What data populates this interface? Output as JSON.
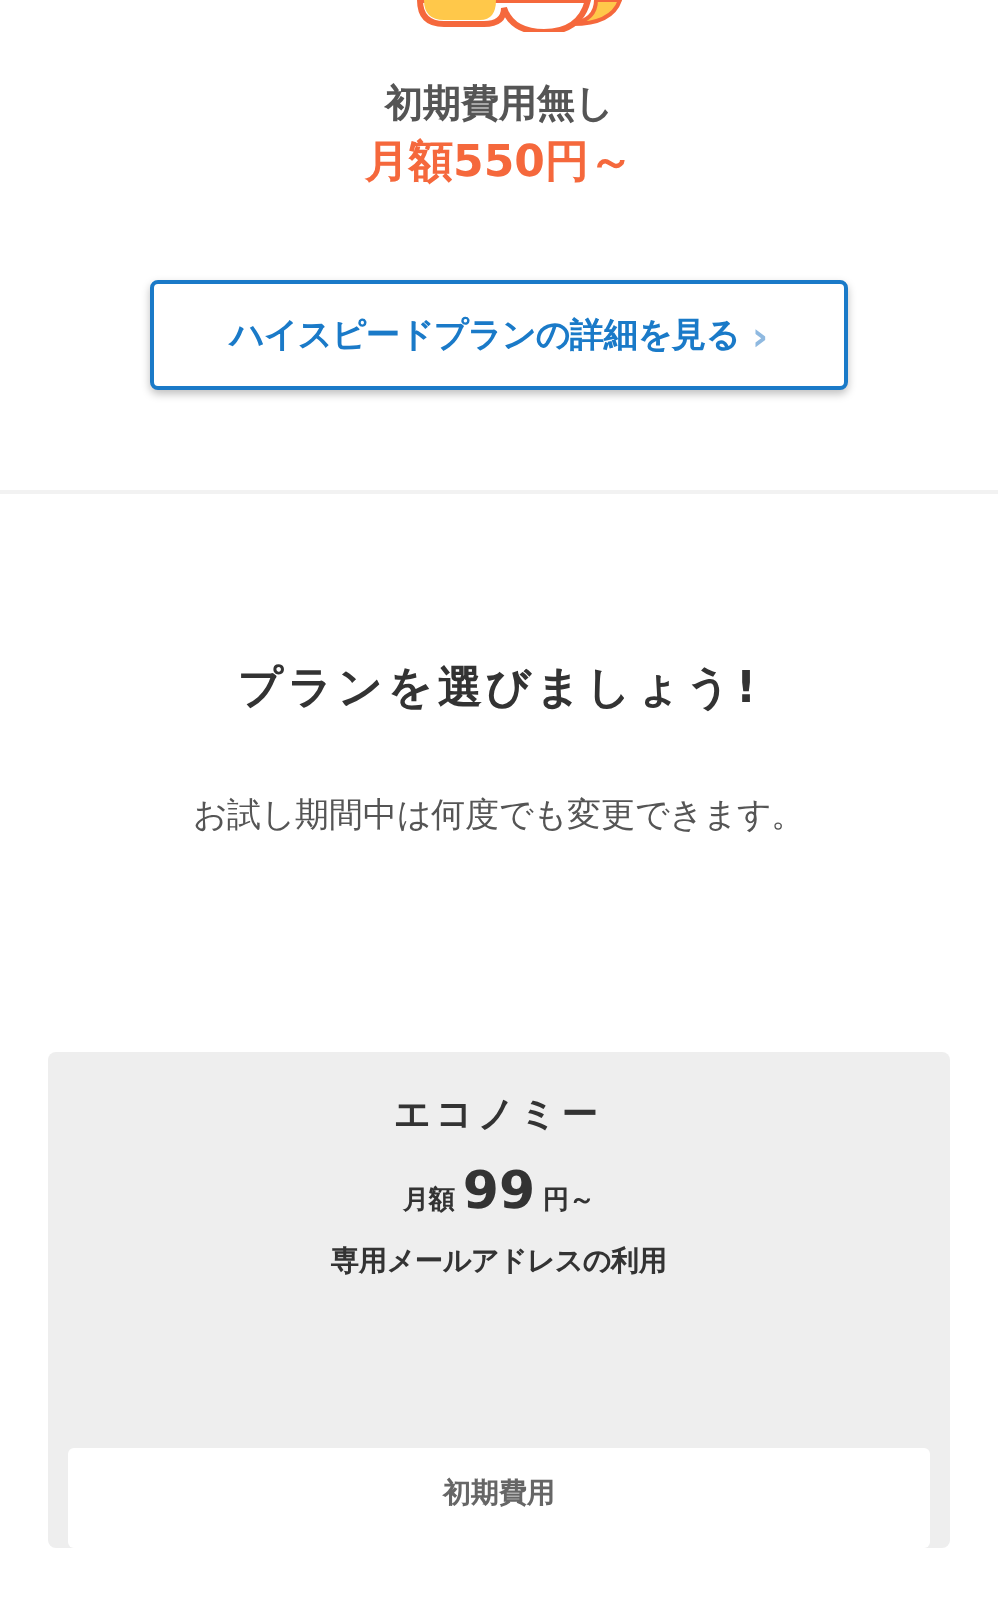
{
  "promo": {
    "fee_note": "初期費用無し",
    "price": "月額550円～",
    "details_button": {
      "label": "ハイスピードプランの詳細を見る",
      "chevron": "›"
    }
  },
  "plans_section": {
    "heading": "プランを選びましょう!",
    "subtitle": "お試し期間中は何度でも変更できます。"
  },
  "plans": [
    {
      "name": "エコノミー",
      "price_prefix": "月額",
      "price": "99",
      "price_suffix": "円～",
      "feature": "専用メールアドレスの利用",
      "detail_label": "初期費用"
    }
  ]
}
